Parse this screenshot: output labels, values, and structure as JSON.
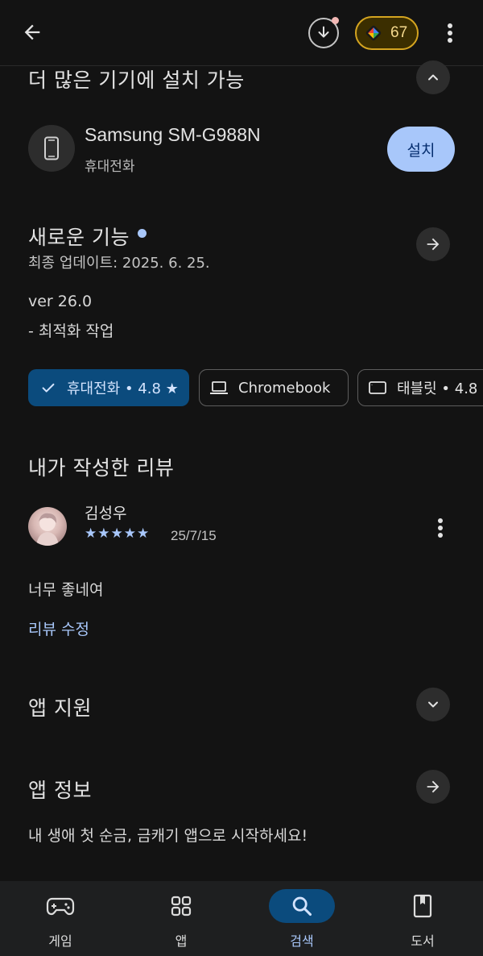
{
  "topbar": {
    "back_icon": "arrow-back-icon",
    "download_icon": "download-icon",
    "points_icon": "play-points-icon",
    "points_value": "67",
    "more_icon": "more-vert-icon"
  },
  "more_devices": {
    "title": "더 많은 기기에 설치 가능",
    "device_name": "Samsung SM-G988N",
    "device_type": "휴대전화",
    "install_label": "설치"
  },
  "whats_new": {
    "title": "새로운 기능",
    "last_updated": "최종 업데이트: 2025. 6. 25.",
    "version": "ver 26.0",
    "notes": "- 최적화 작업"
  },
  "device_chips": [
    {
      "label": "휴대전화 • 4.8 ★",
      "selected": true
    },
    {
      "label": "Chromebook",
      "selected": false
    },
    {
      "label": "태블릿 • 4.8",
      "selected": false
    }
  ],
  "my_review": {
    "title": "내가 작성한 리뷰",
    "reviewer": "김성우",
    "stars": "★★★★★",
    "rating": 5,
    "date": "25/7/15",
    "text": "너무 좋네여",
    "edit_label": "리뷰 수정"
  },
  "app_support": {
    "title": "앱 지원"
  },
  "app_info": {
    "title": "앱 정보",
    "description": "내 생애 첫 순금, 금캐기 앱으로 시작하세요!"
  },
  "bottom_nav": [
    {
      "label": "게임",
      "icon": "gamepad-icon"
    },
    {
      "label": "앱",
      "icon": "apps-grid-icon"
    },
    {
      "label": "검색",
      "icon": "search-icon",
      "active": true
    },
    {
      "label": "도서",
      "icon": "book-icon"
    }
  ],
  "colors": {
    "background": "#131313",
    "accent": "#a8c7fa",
    "chip_active": "#0b4b7d",
    "points_gold": "#d4a420"
  }
}
